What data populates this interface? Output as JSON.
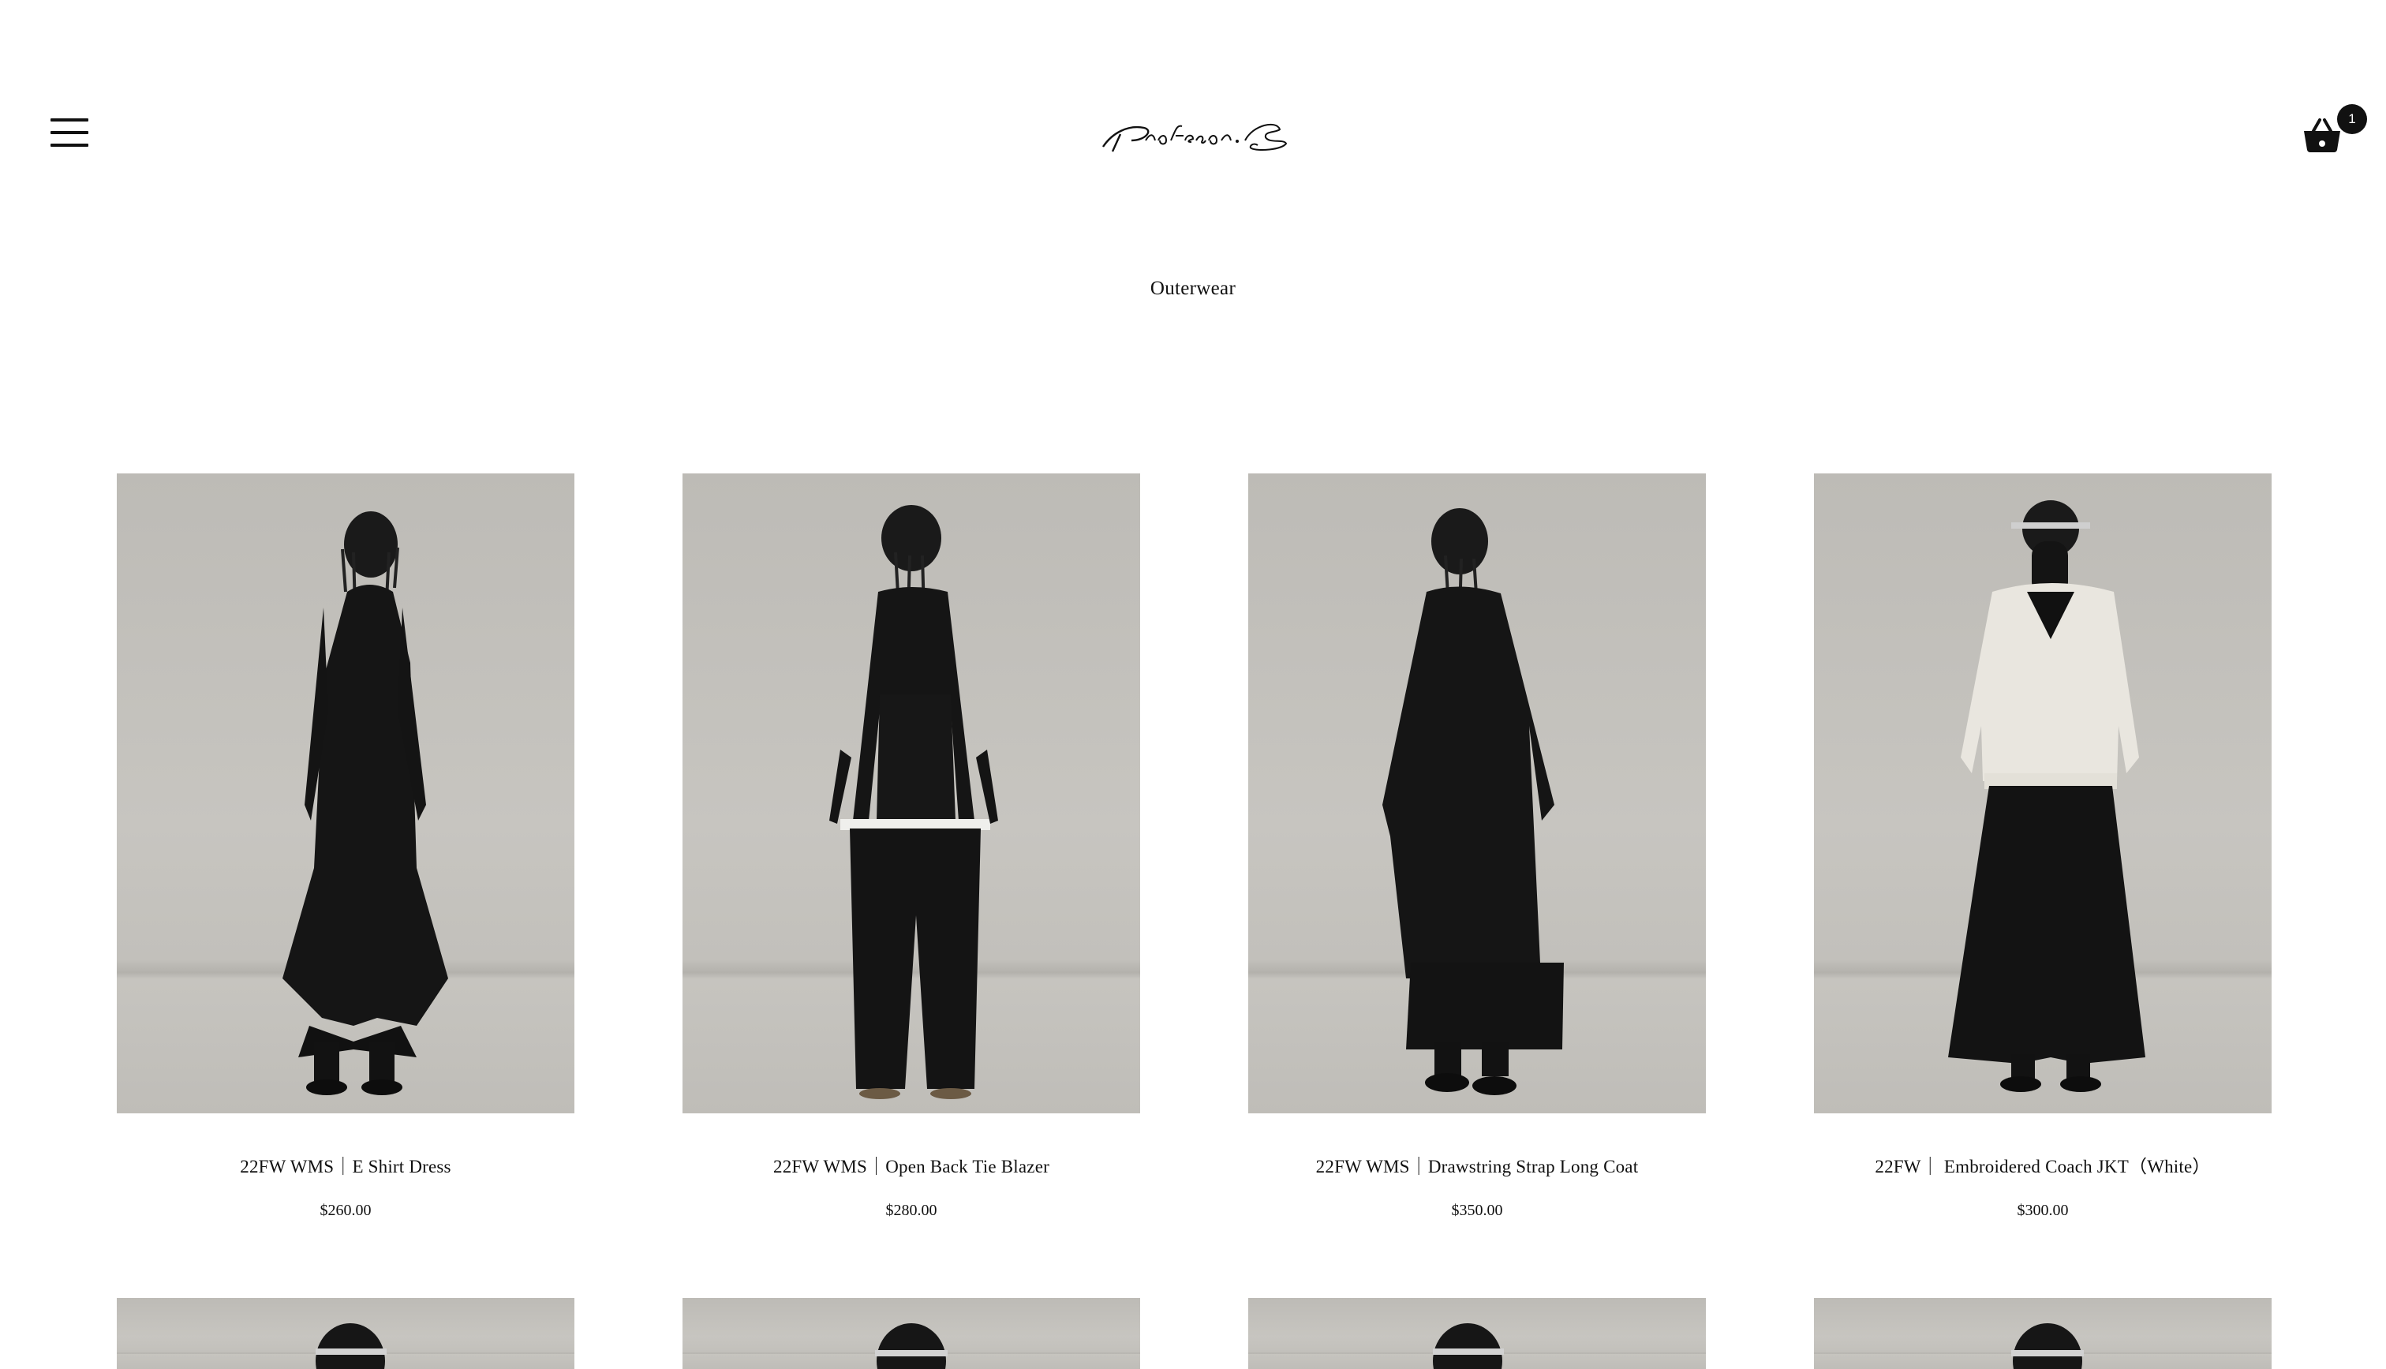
{
  "header": {
    "menu_icon": "hamburger-menu-icon",
    "logo_text": "Professor.E",
    "cart_icon": "shopping-basket-icon",
    "cart_count": "1"
  },
  "page": {
    "title": "Outerwear"
  },
  "products": [
    {
      "name": "22FW WMS｜E Shirt Dress",
      "price": "$260.00",
      "garment_color": "#151515",
      "style": "long-dress"
    },
    {
      "name": "22FW WMS｜Open Back Tie Blazer",
      "price": "$280.00",
      "garment_color": "#151515",
      "style": "blazer-wide-pants"
    },
    {
      "name": "22FW WMS｜Drawstring Strap Long Coat",
      "price": "$350.00",
      "garment_color": "#151515",
      "style": "long-coat"
    },
    {
      "name": "22FW｜ Embroidered Coach JKT（White）",
      "price": "$300.00",
      "garment_color": "#e9e6df",
      "style": "white-jacket-skirt"
    }
  ],
  "products_row2_partial": [
    {
      "garment_color": "#151515"
    },
    {
      "garment_color": "#151515"
    },
    {
      "garment_color": "#151515"
    },
    {
      "garment_color": "#151515"
    }
  ],
  "colors": {
    "background": "#ffffff",
    "text": "#111111",
    "photo_backdrop": "#c4c2bd"
  }
}
